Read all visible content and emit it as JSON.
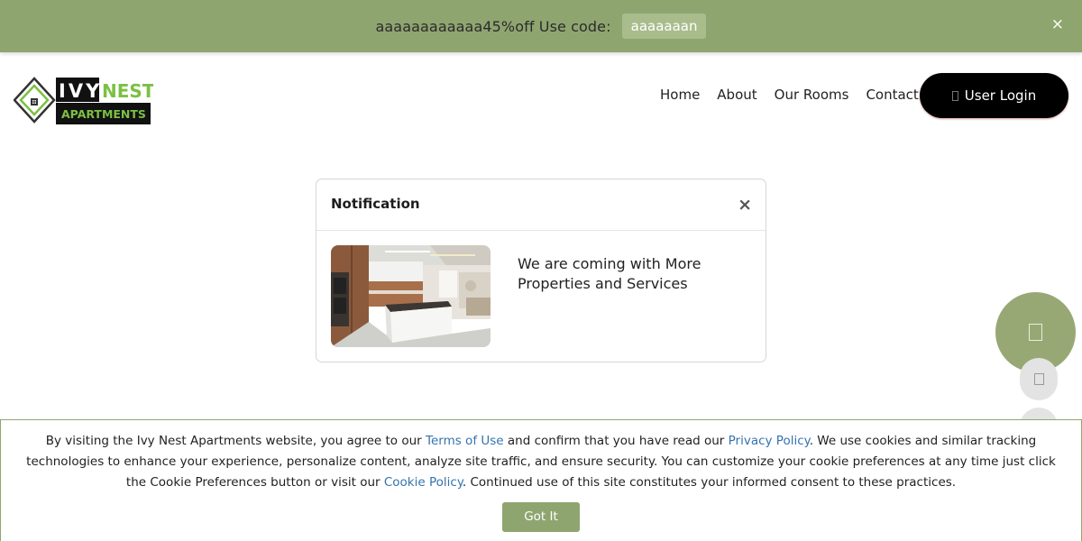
{
  "promo": {
    "text": "aaaaaaaaaaaa45%off Use code:",
    "code": "aaaaaaan",
    "close": "×"
  },
  "logo": {
    "line1a": "IVY",
    "line1b": "NEST",
    "line2": "APARTMENTS"
  },
  "nav": {
    "items": [
      "Home",
      "About",
      "Our Rooms",
      "Contact"
    ],
    "login_label": "User Login"
  },
  "modal": {
    "title": "Notification",
    "close": "×",
    "image_icon": "kitchen-photo",
    "message": "We are coming with More Properties and Services"
  },
  "cookie": {
    "part1": "By visiting the Ivy Nest Apartments website, you agree to our ",
    "terms_link": "Terms of Use",
    "part2": " and confirm that you have read our ",
    "privacy_link": "Privacy Policy",
    "part3": ". We use cookies and similar tracking technologies to enhance your experience, personalize content, analyze site traffic, and ensure security. You can customize your cookie preferences at any time just click the Cookie Preferences button or visit our ",
    "cookie_link": "Cookie Policy",
    "part4": ". Continued use of this site constitutes your informed consent to these practices.",
    "button": "Got It"
  },
  "colors": {
    "brand_green": "#8fa570",
    "logo_green": "#7cc043",
    "link_blue": "#3573b0",
    "login_bg": "#000000"
  }
}
